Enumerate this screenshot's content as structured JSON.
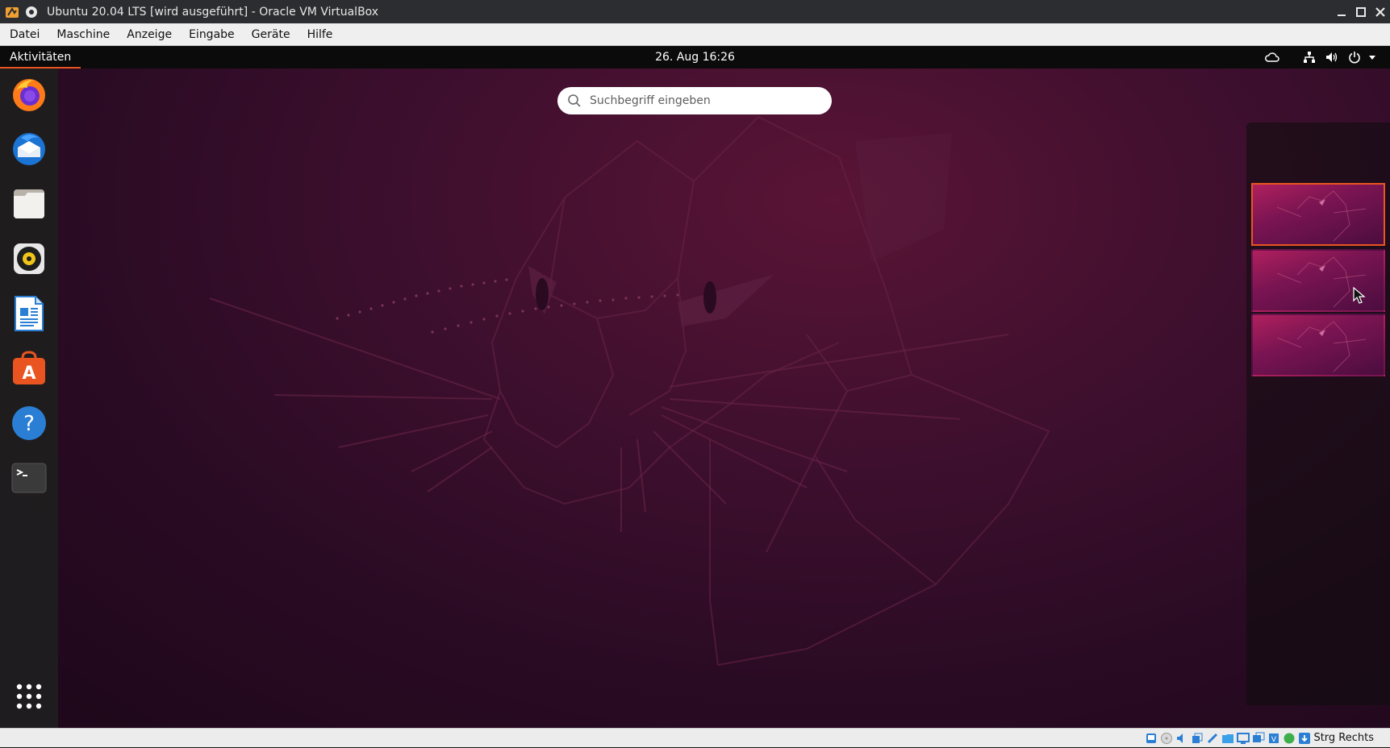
{
  "window": {
    "title": "Ubuntu 20.04 LTS [wird ausgeführt] - Oracle VM VirtualBox"
  },
  "menubar": {
    "items": [
      {
        "label": "Datei"
      },
      {
        "label": "Maschine"
      },
      {
        "label": "Anzeige"
      },
      {
        "label": "Eingabe"
      },
      {
        "label": "Geräte"
      },
      {
        "label": "Hilfe"
      }
    ]
  },
  "topbar": {
    "activities_label": "Aktivitäten",
    "clock": "26. Aug  16:26",
    "tray_icons": [
      "cloud-icon",
      "network-icon",
      "volume-icon",
      "power-icon",
      "chevron-down-icon"
    ]
  },
  "dock": {
    "items": [
      {
        "icon": "firefox-icon"
      },
      {
        "icon": "thunderbird-icon"
      },
      {
        "icon": "files-icon"
      },
      {
        "icon": "rhythmbox-icon"
      },
      {
        "icon": "libreoffice-writer-icon"
      },
      {
        "icon": "ubuntu-software-icon"
      },
      {
        "icon": "help-icon"
      },
      {
        "icon": "terminal-icon"
      }
    ],
    "show_apps_icon": "app-grid-icon"
  },
  "search": {
    "placeholder": "Suchbegriff eingeben",
    "icon": "search-icon"
  },
  "workspaces": {
    "count": 3,
    "active_index": 0
  },
  "statusbar": {
    "host_key_label": "Strg Rechts",
    "icons": [
      "hard-disk-icon",
      "optical-drive-icon",
      "audio-icon",
      "network-adapter-icon",
      "usb-icon",
      "shared-folder-icon",
      "display-icon",
      "video-capture-icon",
      "cpu-icon",
      "mouse-integration-icon",
      "keyboard-capture-icon"
    ]
  },
  "colors": {
    "accent": "#e95420",
    "topbar_bg": "#0b0b0b",
    "wallpaper_base": "#2a0c22"
  }
}
